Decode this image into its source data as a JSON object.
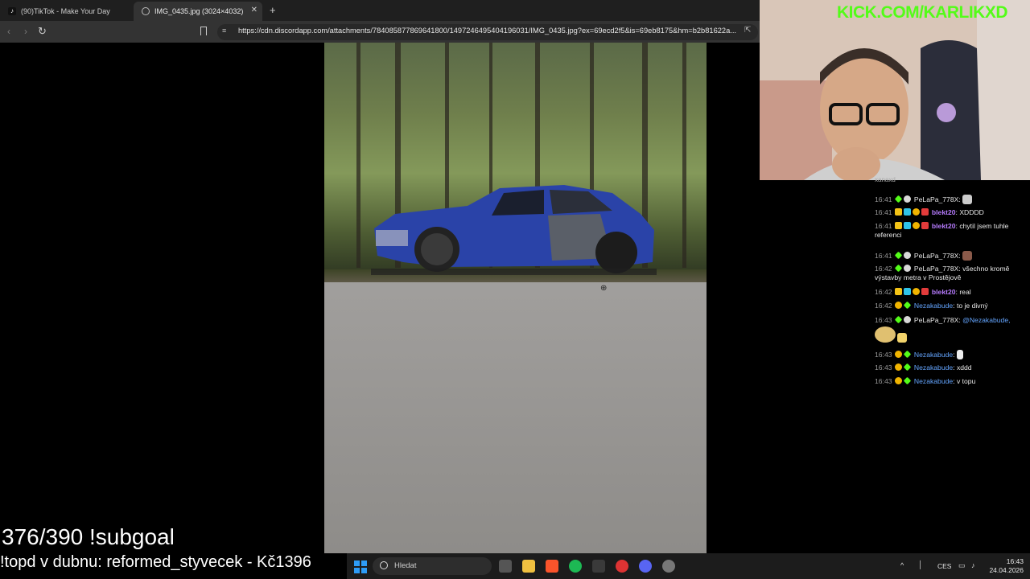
{
  "browser": {
    "tabs": [
      {
        "title": "(90)TikTok - Make Your Day",
        "active": false
      },
      {
        "title": "IMG_0435.jpg (3024×4032)",
        "active": true
      }
    ],
    "url": "https://cdn.discordapp.com/attachments/784085877869641800/1497246495404196031/IMG_0435.jpg?ex=69ecd2f5&is=69eb8175&hm=b2b81622a..."
  },
  "overlay": {
    "kick_url": "KICK.COM/KARLIKXD",
    "subgoal": "376/390 !subgoal",
    "top_donation": "!topd v dubnu: reformed_styvecek - Kč1396"
  },
  "chat": {
    "messages": [
      {
        "time": "16:41",
        "user": "PeLaPa_778X",
        "text": ""
      },
      {
        "time": "16:41",
        "user": "blekt20",
        "text": "XDDDD"
      },
      {
        "time": "16:41",
        "user": "blekt20",
        "text": "chytil jsem tuhle referenci"
      },
      {
        "time": "16:41",
        "user": "PeLaPa_778X",
        "text": ""
      },
      {
        "time": "16:42",
        "user": "PeLaPa_778X",
        "text": "všechno kromě výstavby metra v Prostějově"
      },
      {
        "time": "16:42",
        "user": "blekt20",
        "text": "real"
      },
      {
        "time": "16:42",
        "user": "Nezakabude",
        "text": "to je divný"
      },
      {
        "time": "16:43",
        "user": "PeLaPa_778X",
        "text": "",
        "mention": "@Nezakabude,"
      },
      {
        "time": "16:43",
        "user": "Nezakabude",
        "text": ""
      },
      {
        "time": "16:43",
        "user": "Nezakabude",
        "text": "xddd"
      },
      {
        "time": "16:43",
        "user": "Nezakabude",
        "text": "v topu"
      }
    ]
  },
  "taskbar": {
    "search_label": "Hledat",
    "language": "CES",
    "time": "16:43",
    "date": "24.04.2026"
  },
  "colors": {
    "kick_green": "#53fc18",
    "chat_purple": "#b77cff",
    "chat_blue": "#64a5ff",
    "car_blue": "#2a43a8"
  },
  "icons": [
    "tiktok-icon",
    "globe-icon",
    "close-icon",
    "plus-icon",
    "back-icon",
    "forward-icon",
    "reload-icon",
    "bookmark-icon",
    "site-settings-icon",
    "share-icon",
    "zoom-cursor-icon",
    "windows-start-icon",
    "search-icon",
    "task-view-icon",
    "file-explorer-icon",
    "brave-icon",
    "spotify-icon",
    "sublime-icon",
    "ccleaner-icon",
    "discord-icon",
    "chrome-icon",
    "chevron-up-icon",
    "mic-icon",
    "monitor-icon",
    "speaker-icon"
  ]
}
